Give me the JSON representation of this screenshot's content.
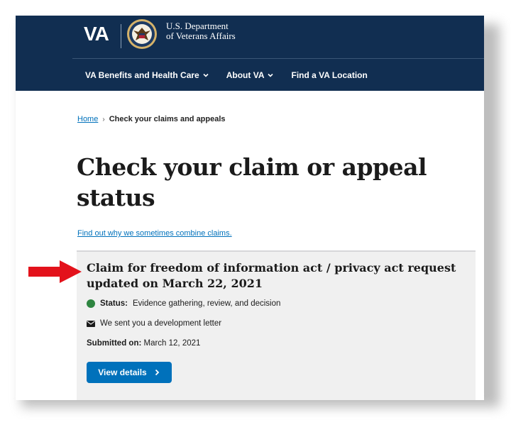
{
  "header": {
    "logo_text": "VA",
    "dept_line1": "U.S. Department",
    "dept_line2": "of Veterans Affairs",
    "nav": [
      {
        "label": "VA Benefits and Health Care",
        "icon": "chevron-down-icon"
      },
      {
        "label": "About VA",
        "icon": "chevron-down-icon"
      },
      {
        "label": "Find a VA Location"
      }
    ]
  },
  "breadcrumb": {
    "home": "Home",
    "separator": "›",
    "current": "Check your claims and appeals"
  },
  "page": {
    "title": "Check your claim or appeal status",
    "combine_link": "Find out why we sometimes combine claims."
  },
  "claim_card": {
    "title": "Claim for freedom of information act / privacy act request updated on March 22, 2021",
    "status_label": "Status:",
    "status_value": "Evidence gathering, review, and decision",
    "status_color": "#2e8540",
    "letter_text": "We sent you a development letter",
    "letter_icon": "envelope-icon",
    "submitted_label": "Submitted on:",
    "submitted_value": "March 12, 2021",
    "button_label": "View details",
    "button_icon": "chevron-right-icon"
  },
  "annotation": {
    "arrow_color": "#e3121b"
  },
  "colors": {
    "header_bg": "#112e51",
    "link": "#0071bb",
    "card_bg": "#f0f0f0"
  }
}
